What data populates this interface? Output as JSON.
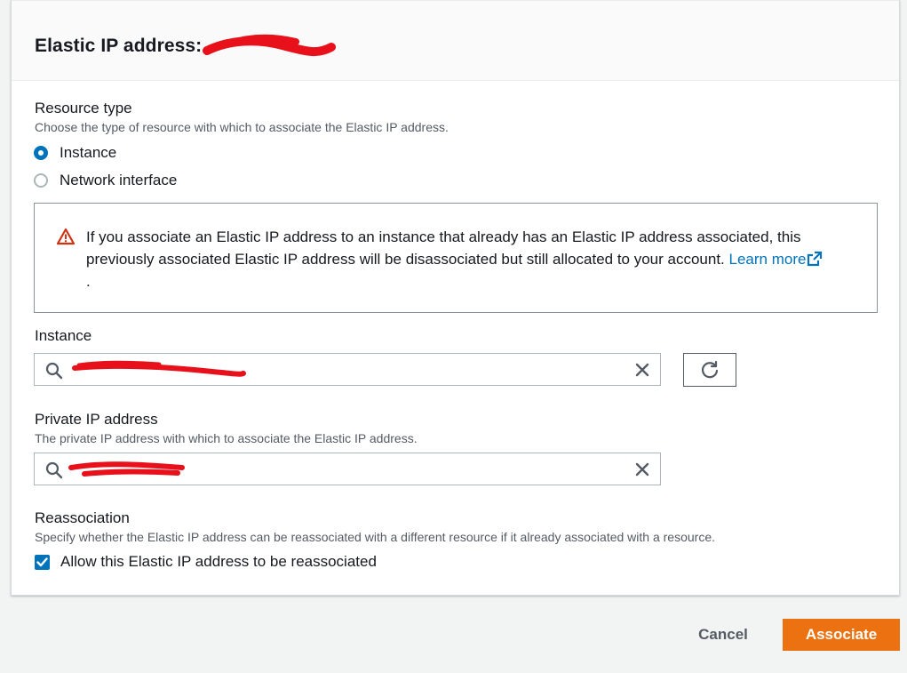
{
  "card": {
    "title": "Elastic IP address: "
  },
  "resource_type": {
    "label": "Resource type",
    "description": "Choose the type of resource with which to associate the Elastic IP address.",
    "options": [
      {
        "label": "Instance",
        "checked": true
      },
      {
        "label": "Network interface",
        "checked": false
      }
    ]
  },
  "alert": {
    "text": "If you associate an Elastic IP address to an instance that already has an Elastic IP address associated, this previously associated Elastic IP address will be disassociated but still allocated to your account.",
    "link_text": "Learn more",
    "trailing": "."
  },
  "instance": {
    "label": "Instance"
  },
  "private_ip": {
    "label": "Private IP address",
    "description": "The private IP address with which to associate the Elastic IP address."
  },
  "reassociation": {
    "label": "Reassociation",
    "description": "Specify whether the Elastic IP address can be reassociated with a different resource if it already associated with a resource.",
    "checkbox_label": "Allow this Elastic IP address to be reassociated",
    "checked": true
  },
  "footer": {
    "cancel_label": "Cancel",
    "associate_label": "Associate"
  },
  "colors": {
    "primary": "#ec7211",
    "link": "#0073bb",
    "warning": "#d13212",
    "redaction": "#e8101a"
  },
  "icons": [
    "warning-icon",
    "external-link-icon",
    "search-icon",
    "clear-icon",
    "refresh-icon",
    "check-icon"
  ]
}
